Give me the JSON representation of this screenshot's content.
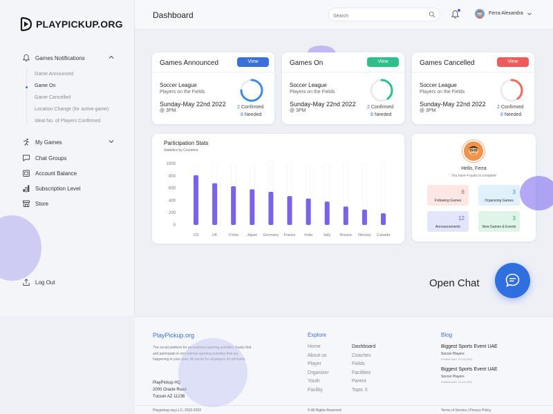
{
  "brand": {
    "logo_text": "PLAYPICKUP.ORG"
  },
  "sidebar": {
    "games_notifications": "Games Notifications",
    "sub_items": [
      "Game Announced",
      "Game On",
      "Game Cancelled",
      "Location Change (for active game)",
      "Ideal No. of Players Confirmed"
    ],
    "active_sub_item": "Game On",
    "my_games": "My Games",
    "chat_groups": "Chat Groups",
    "account_balance": "Account Balance",
    "subscription_level": "Subscription Level",
    "store": "Store",
    "log_out": "Log Out"
  },
  "header": {
    "title": "Dashboard",
    "search_placeholder": "Search",
    "user_name": "Ferra Alexandra"
  },
  "game_cards": [
    {
      "title": "Games Announced",
      "button": "View",
      "button_color": "#3b6fd9",
      "ring_color": "#3b8be0",
      "league": "Soccer League",
      "players": "Players on the Fields",
      "date": "Sunday-May 22nd 2022",
      "time": "@ 3PM",
      "confirmed_num": "2",
      "confirmed_label": " Confirmed",
      "needed_num": "8",
      "needed_label": " Needed",
      "progress": 0.75
    },
    {
      "title": "Games On",
      "button": "View",
      "button_color": "#2ec08a",
      "ring_color": "#2ec08a",
      "league": "Soccer League",
      "players": "Players on the Fields",
      "date": "Sunday-May 22nd 2022",
      "time": "@ 3PM",
      "confirmed_num": "2",
      "confirmed_label": " Confirmed",
      "needed_num": "8",
      "needed_label": " Needed",
      "progress": 0.4
    },
    {
      "title": "Games Cancelled",
      "button": "View",
      "button_color": "#ef5b5b",
      "ring_color": "#ef6a5b",
      "league": "Soccer League",
      "players": "Players on the Fields",
      "date": "Sunday-May 22nd 2022",
      "time": "@ 3PM",
      "confirmed_num": "2",
      "confirmed_label": " Confirmed",
      "needed_num": "8",
      "needed_label": " Needed",
      "progress": 0.4
    }
  ],
  "stats": {
    "title": "Participation Stats",
    "subtitle": "Statistics by Countries"
  },
  "chart_data": {
    "type": "bar",
    "categories": [
      "US",
      "UK",
      "China",
      "Japan",
      "Germany",
      "France",
      "India",
      "Italy",
      "Russia",
      "Norway",
      "Canada"
    ],
    "values": [
      810,
      680,
      630,
      580,
      540,
      470,
      430,
      380,
      300,
      250,
      190
    ],
    "totals": [
      1000,
      1000,
      1000,
      1000,
      1050,
      1000,
      1000,
      1000,
      1000,
      1000,
      1020
    ],
    "yticks": [
      "0",
      "200",
      "400",
      "600",
      "800",
      "1000"
    ],
    "ylim": [
      0,
      1000
    ],
    "bar_color": "#7b63e8",
    "track_color": "#ffffff"
  },
  "profile": {
    "hello": "Hello, Ferra",
    "tasks": "You have 4 tasks to complete",
    "tiles": [
      {
        "num": "8",
        "label": "Following Games",
        "bg": "#fde7e4",
        "color": "#e45a4e"
      },
      {
        "num": "3",
        "label": "Organizing Games",
        "bg": "#e1f1fb",
        "color": "#3b8be0"
      },
      {
        "num": "12",
        "label": "Announcements",
        "bg": "#e3e6fb",
        "color": "#5a6ee0"
      },
      {
        "num": "3",
        "label": "New Games & Events",
        "bg": "#dff5ea",
        "color": "#2ea675"
      }
    ]
  },
  "chat": {
    "label": "Open Chat"
  },
  "footer": {
    "brand": "PlayPickup.org",
    "description": "The social platform for recreational sporting activities. Easily find and participate in recreational sporting activities that are happening in your area. All sports for all players for all levels.",
    "address_name": "PlayPickup HQ",
    "address_line1": "2000 Oracle Road",
    "address_line2": "Tucson AZ 11236",
    "explore_heading": "Explore",
    "explore_col1": [
      "Home",
      "About us",
      "Player",
      "Organizer",
      "Youth",
      "Facility"
    ],
    "explore_col2": [
      "Dashboard",
      "Coaches",
      "Fields",
      "Facilities",
      "Parent",
      "Topic X"
    ],
    "blog_heading": "Blog",
    "blog_posts": [
      {
        "title": "Biggest Sports Event UAE",
        "tag": "Soccer Players",
        "date": "Publish Date: 21-03-2022"
      },
      {
        "title": "Biggest Sports Event UAE",
        "tag": "Soccer Players",
        "date": "Publish Date: 21-03-2022"
      }
    ],
    "copyright": "Playpickup.org LLC, 2022-2022",
    "rights": "© All Rights Reserved",
    "terms": "Terms of Service | Privacy Policy"
  }
}
